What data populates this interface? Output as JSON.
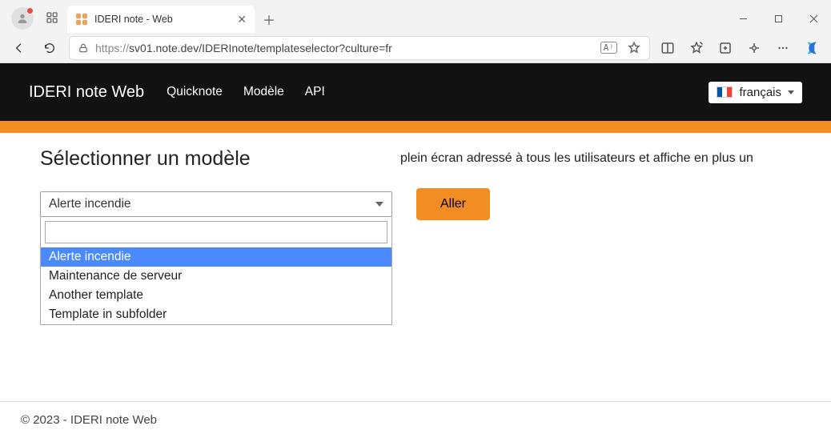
{
  "browser": {
    "tab_title": "IDERI note - Web",
    "url_proto": "https://",
    "url_rest": "sv01.note.dev/IDERInote/templateselector?culture=fr",
    "reader_label": "A⁾"
  },
  "nav": {
    "brand": "IDERI note Web",
    "links": [
      "Quicknote",
      "Modèle",
      "API"
    ],
    "language": "français"
  },
  "page": {
    "title": "Sélectionner un modèle",
    "selected_template": "Alerte incendie",
    "go_label": "Aller",
    "description": "plein écran adressé à tous les utilisateurs et affiche en plus un",
    "templates": [
      "Alerte incendie",
      "Maintenance de serveur",
      "Another template",
      "Template in subfolder"
    ]
  },
  "footer": {
    "text": "© 2023 - IDERI note Web"
  }
}
